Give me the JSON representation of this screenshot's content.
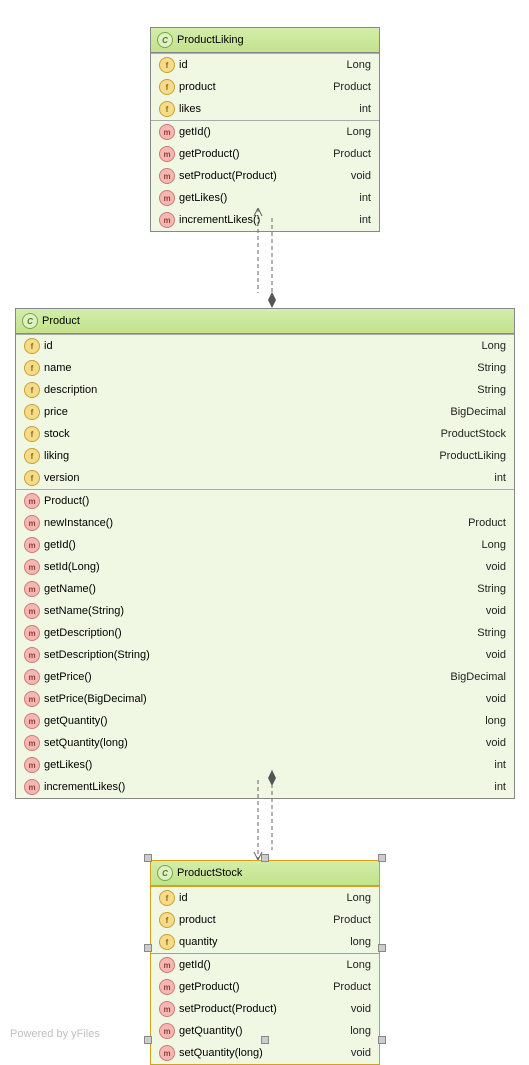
{
  "classes": {
    "ProductLiking": {
      "name": "ProductLiking",
      "fields": [
        {
          "name": "id",
          "type": "Long"
        },
        {
          "name": "product",
          "type": "Product"
        },
        {
          "name": "likes",
          "type": "int"
        }
      ],
      "methods": [
        {
          "name": "getId()",
          "type": "Long"
        },
        {
          "name": "getProduct()",
          "type": "Product"
        },
        {
          "name": "setProduct(Product)",
          "type": "void"
        },
        {
          "name": "getLikes()",
          "type": "int"
        },
        {
          "name": "incrementLikes()",
          "type": "int"
        }
      ]
    },
    "Product": {
      "name": "Product",
      "fields": [
        {
          "name": "id",
          "type": "Long"
        },
        {
          "name": "name",
          "type": "String"
        },
        {
          "name": "description",
          "type": "String"
        },
        {
          "name": "price",
          "type": "BigDecimal"
        },
        {
          "name": "stock",
          "type": "ProductStock"
        },
        {
          "name": "liking",
          "type": "ProductLiking"
        },
        {
          "name": "version",
          "type": "int"
        }
      ],
      "methods": [
        {
          "name": "Product()",
          "type": ""
        },
        {
          "name": "newInstance()",
          "type": "Product"
        },
        {
          "name": "getId()",
          "type": "Long"
        },
        {
          "name": "setId(Long)",
          "type": "void"
        },
        {
          "name": "getName()",
          "type": "String"
        },
        {
          "name": "setName(String)",
          "type": "void"
        },
        {
          "name": "getDescription()",
          "type": "String"
        },
        {
          "name": "setDescription(String)",
          "type": "void"
        },
        {
          "name": "getPrice()",
          "type": "BigDecimal"
        },
        {
          "name": "setPrice(BigDecimal)",
          "type": "void"
        },
        {
          "name": "getQuantity()",
          "type": "long"
        },
        {
          "name": "setQuantity(long)",
          "type": "void"
        },
        {
          "name": "getLikes()",
          "type": "int"
        },
        {
          "name": "incrementLikes()",
          "type": "int"
        }
      ]
    },
    "ProductStock": {
      "name": "ProductStock",
      "fields": [
        {
          "name": "id",
          "type": "Long"
        },
        {
          "name": "product",
          "type": "Product"
        },
        {
          "name": "quantity",
          "type": "long"
        }
      ],
      "methods": [
        {
          "name": "getId()",
          "type": "Long"
        },
        {
          "name": "getProduct()",
          "type": "Product"
        },
        {
          "name": "setProduct(Product)",
          "type": "void"
        },
        {
          "name": "getQuantity()",
          "type": "long"
        },
        {
          "name": "setQuantity(long)",
          "type": "void"
        }
      ]
    }
  },
  "footer": "Powered by yFiles",
  "icons": {
    "class": "C",
    "field": "f",
    "method": "m"
  }
}
